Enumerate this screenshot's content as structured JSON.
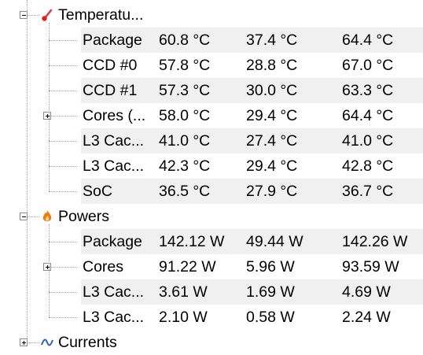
{
  "groups": [
    {
      "label": "Temperatu...",
      "icon": "thermometer-icon",
      "rows": [
        {
          "name": "Package",
          "current": "60.8 °C",
          "min": "37.4 °C",
          "max": "64.4 °C",
          "expandable": false
        },
        {
          "name": "CCD #0",
          "current": "57.8 °C",
          "min": "28.8 °C",
          "max": "67.0 °C",
          "expandable": false
        },
        {
          "name": "CCD #1",
          "current": "57.3 °C",
          "min": "30.0 °C",
          "max": "63.3 °C",
          "expandable": false
        },
        {
          "name": "Cores (...",
          "current": "58.0 °C",
          "min": "29.4 °C",
          "max": "64.4 °C",
          "expandable": true
        },
        {
          "name": "L3 Cac...",
          "current": "41.0 °C",
          "min": "27.4 °C",
          "max": "41.0 °C",
          "expandable": false
        },
        {
          "name": "L3 Cac...",
          "current": "42.3 °C",
          "min": "29.4 °C",
          "max": "42.8 °C",
          "expandable": false
        },
        {
          "name": "SoC",
          "current": "36.5 °C",
          "min": "27.9 °C",
          "max": "36.7 °C",
          "expandable": false
        }
      ]
    },
    {
      "label": "Powers",
      "icon": "flame-icon",
      "rows": [
        {
          "name": "Package",
          "current": "142.12 W",
          "min": "49.44 W",
          "max": "142.26 W",
          "expandable": false
        },
        {
          "name": "Cores",
          "current": "91.22 W",
          "min": "5.96 W",
          "max": "93.59 W",
          "expandable": true
        },
        {
          "name": "L3 Cac...",
          "current": "3.61 W",
          "min": "1.69 W",
          "max": "4.69 W",
          "expandable": false
        },
        {
          "name": "L3 Cac...",
          "current": "2.10 W",
          "min": "0.58 W",
          "max": "2.24 W",
          "expandable": false
        }
      ]
    },
    {
      "label": "Currents",
      "icon": "current-wave-icon",
      "rows": []
    }
  ],
  "colors": {
    "row_stripe": "#f0f0f0",
    "thermometer_red": "#e02020",
    "flame_orange": "#f07a10",
    "current_blue": "#3060c0"
  }
}
